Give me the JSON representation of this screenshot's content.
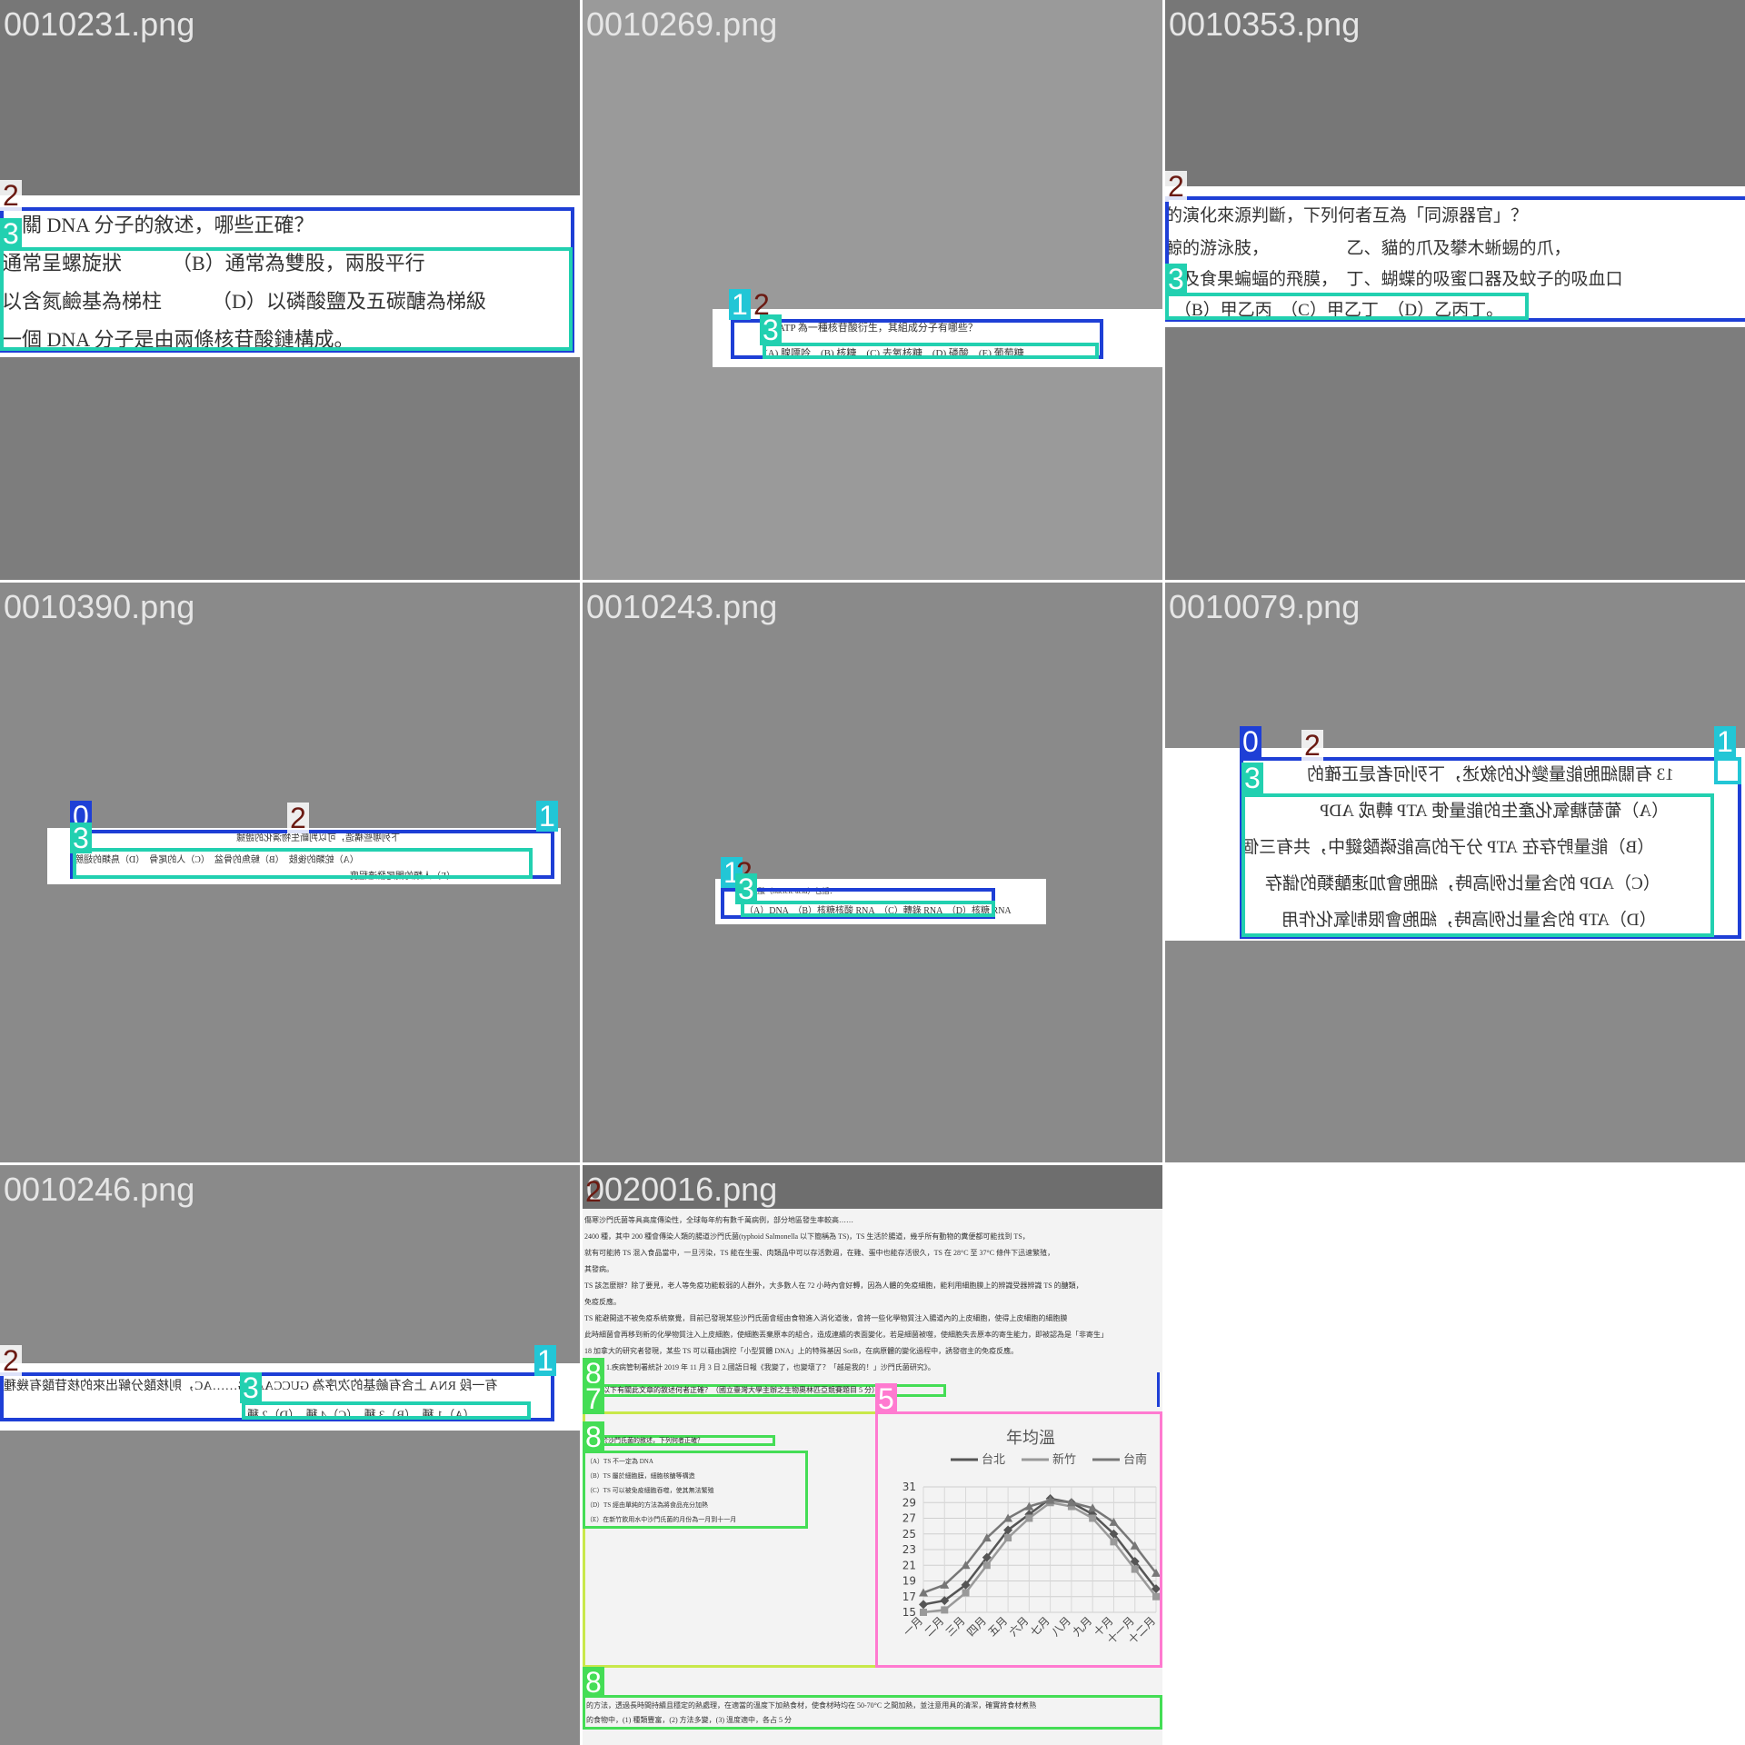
{
  "tiles": [
    {
      "filename": "0010231.png",
      "lines": [
        "關 DNA 分子的敘述，哪些正確？",
        "通常呈螺旋狀　　　（B）通常為雙股，兩股平行",
        "以含氮鹼基為梯柱　　　（D）以磷酸鹽及五碳醣為梯級",
        "一個 DNA 分子是由兩條核苷酸鏈構成。"
      ],
      "tags": [
        "2",
        "3"
      ]
    },
    {
      "filename": "0010269.png",
      "lines": [
        "ATP 為一種核苷酸衍生，其組成分子有哪些？",
        "(A) 腺嘌呤　(B) 核糖　(C) 去氧核糖　(D) 磷酸　(E) 葡萄糖"
      ],
      "tags": [
        "1",
        "2",
        "3"
      ]
    },
    {
      "filename": "0010353.png",
      "lines": [
        "的演化來源判斷，下列何者互為「同源器官」？",
        "鯨的游泳肢，　　　　　乙、貓的爪及攀木蜥蜴的爪，",
        "翅及食果蝙蝠的飛膜，　丁、蝴蝶的吸蜜口器及蚊子的吸血口",
        "（B）甲乙丙　（C）甲乙丁　（D）乙丙丁。"
      ],
      "tags": [
        "2",
        "3"
      ]
    },
    {
      "filename": "0010390.png",
      "lines": [
        "下列哪些構造，可以判斷生物演化的證據",
        "（A）蛇類的後肢　（B）鯨魚的骨盆　（C）人的尾骨　（D）鳥類的翅膀",
        "（E）人類的闌尾發達程度"
      ],
      "tags": [
        "0",
        "2",
        "1",
        "3"
      ]
    },
    {
      "filename": "0010243.png",
      "lines": [
        "核酸（nucleic acid）包括：",
        "（A）DNA　（B）核糖核酸 RNA　（C）轉錄 RNA　（D）核糖 RNA"
      ],
      "tags": [
        "1",
        "2",
        "3"
      ]
    },
    {
      "filename": "0010079.png",
      "lines": [
        "13 有關細胞能量變化的敘述，下列何者是正確的",
        "（A）葡萄糖氧化產生的能量使 ATP 轉成 ADP",
        "（B）能量貯存在 ATP 分子的高能磷酸鍵中，共有三個",
        "（C）ADP 的含量比例高時，細胞會加速醣類的儲存",
        "（D）ATP 的含量比例高時，細胞會限制氧化作用"
      ],
      "tags": [
        "0",
        "2",
        "1",
        "3"
      ]
    },
    {
      "filename": "0010246.png",
      "lines": [
        "有一段 RNA 上含有鹼基的次序為 GUCCAACG……AC，則核酸分解出來的核苷酸有幾種",
        "（A）1 種　（B）3 種　（C）4 種　（D）2 種"
      ],
      "tags": [
        "2",
        "1",
        "3"
      ]
    },
    {
      "filename": "0020016.png",
      "header_lines": [
        "傷寒沙門氏菌等具高度傳染性，全球每年約有數千萬病例，部分地區發生率較高……",
        "2400 種，其中 200 種會傳染人類的腸道沙門氏菌(typhoid Salmonella 以下簡稱為 TS)，TS 生活於腸道，幾乎所有動物的糞便都可能找到 TS，",
        "就有可能將 TS 混入食品當中，一旦污染，TS 能在生蛋、肉類品中可以存活數週，在雞、蛋中也能存活很久，TS 在 28°C 至 37°C 條件下迅速繁殖，",
        "其發病。",
        "TS 該怎麼辦？除了要見，老人等免疫功能較弱的人群外，大多數人在 72 小時內會好轉，因為人體的免疫細胞，能利用細胞膜上的辨識受器辨識 TS 的醣類，",
        "免疫反應。",
        "TS 能避開這不被免疫系統察覺，目前已發現某些沙門氏菌會經由食物進入消化道後，會將一些化學物質注入腸道內的上皮細胞，使得上皮細胞的細胞膜",
        "此時細菌會再移到新的化學物質注入上皮細胞，使細胞丟棄原本的組合，造成連續的表面變化，若是細菌被噬，使細胞失去原本的寄生能力，即被認為是「非寄生」",
        "18 加拿大的研究者發現，某些 TS 可以藉由調控「小型質體 DNA」上的特殊基因 SorB，在病原體的變化過程中，誘發宿主的免疫反應。",
        "資料：1.疾病管制署統計 2019 年 11 月 3 日 2.國語日報《我變了，也變壞了？「越是我的！」沙門氏菌研究》。"
      ],
      "question_line": "乙、以下有關此文章的敘述何者正確？（國立臺灣大學主辦之生物奧林匹亞競賽題目 5 分）",
      "list_title": "關於沙門氏菌的敘述，下列何者正確？",
      "list_lines": [
        "（A）TS 不一定為 DNA",
        "（B）TS 屬於細胞膜，細胞核醣等構造",
        "（C）TS 可以被免疫細胞吞噬，使其無法繁殖",
        "（D）TS 經由單純的方法為將食品充分加熱",
        "（E）在新竹飲用水中沙門氏菌的月份為一月到十一月"
      ],
      "footer_lines": [
        "的方法，透過長時間持續且穩定的熱處理，在適當的溫度下加熱食材，使食材時均在 50-70°C 之間加熱，並注意用具的清潔，確實將食材煮熟",
        "的食物中，(1) 種類豐富，(2) 方法多變，(3) 溫度適中，各占 5 分"
      ],
      "tags": [
        "2",
        "8",
        "7",
        "5",
        "8",
        "8"
      ]
    }
  ],
  "chart_data": {
    "type": "line",
    "title": "年均溫",
    "categories": [
      "一月",
      "二月",
      "三月",
      "四月",
      "五月",
      "六月",
      "七月",
      "八月",
      "九月",
      "十月",
      "十一月",
      "十二月"
    ],
    "series": [
      {
        "name": "台北",
        "values": [
          16,
          16.5,
          18.5,
          22,
          25.5,
          27.5,
          29.5,
          29,
          27.5,
          25,
          21.5,
          18
        ],
        "color": "#555555"
      },
      {
        "name": "新竹",
        "values": [
          15,
          15.3,
          17.5,
          21,
          24.5,
          27,
          29,
          28.5,
          27,
          24,
          20.5,
          17
        ],
        "color": "#999999"
      },
      {
        "name": "台南",
        "values": [
          17.5,
          18.5,
          21,
          24.5,
          27,
          28.5,
          29.3,
          29,
          28.3,
          26.5,
          23.5,
          20
        ],
        "color": "#777777"
      }
    ],
    "ylim": [
      15,
      31
    ],
    "yticks": [
      15,
      17,
      19,
      21,
      23,
      25,
      27,
      29,
      31
    ],
    "grid": true,
    "legend": "top"
  },
  "colors": {
    "background_gray": "#8a8a8a",
    "box_blue": "#1e3fd6",
    "box_teal": "#22d0b0",
    "box_green": "#44dd55",
    "box_yellow_green": "#c8e84a",
    "box_pink": "#ff7ad0",
    "tag_brown": "#6b1a12"
  }
}
